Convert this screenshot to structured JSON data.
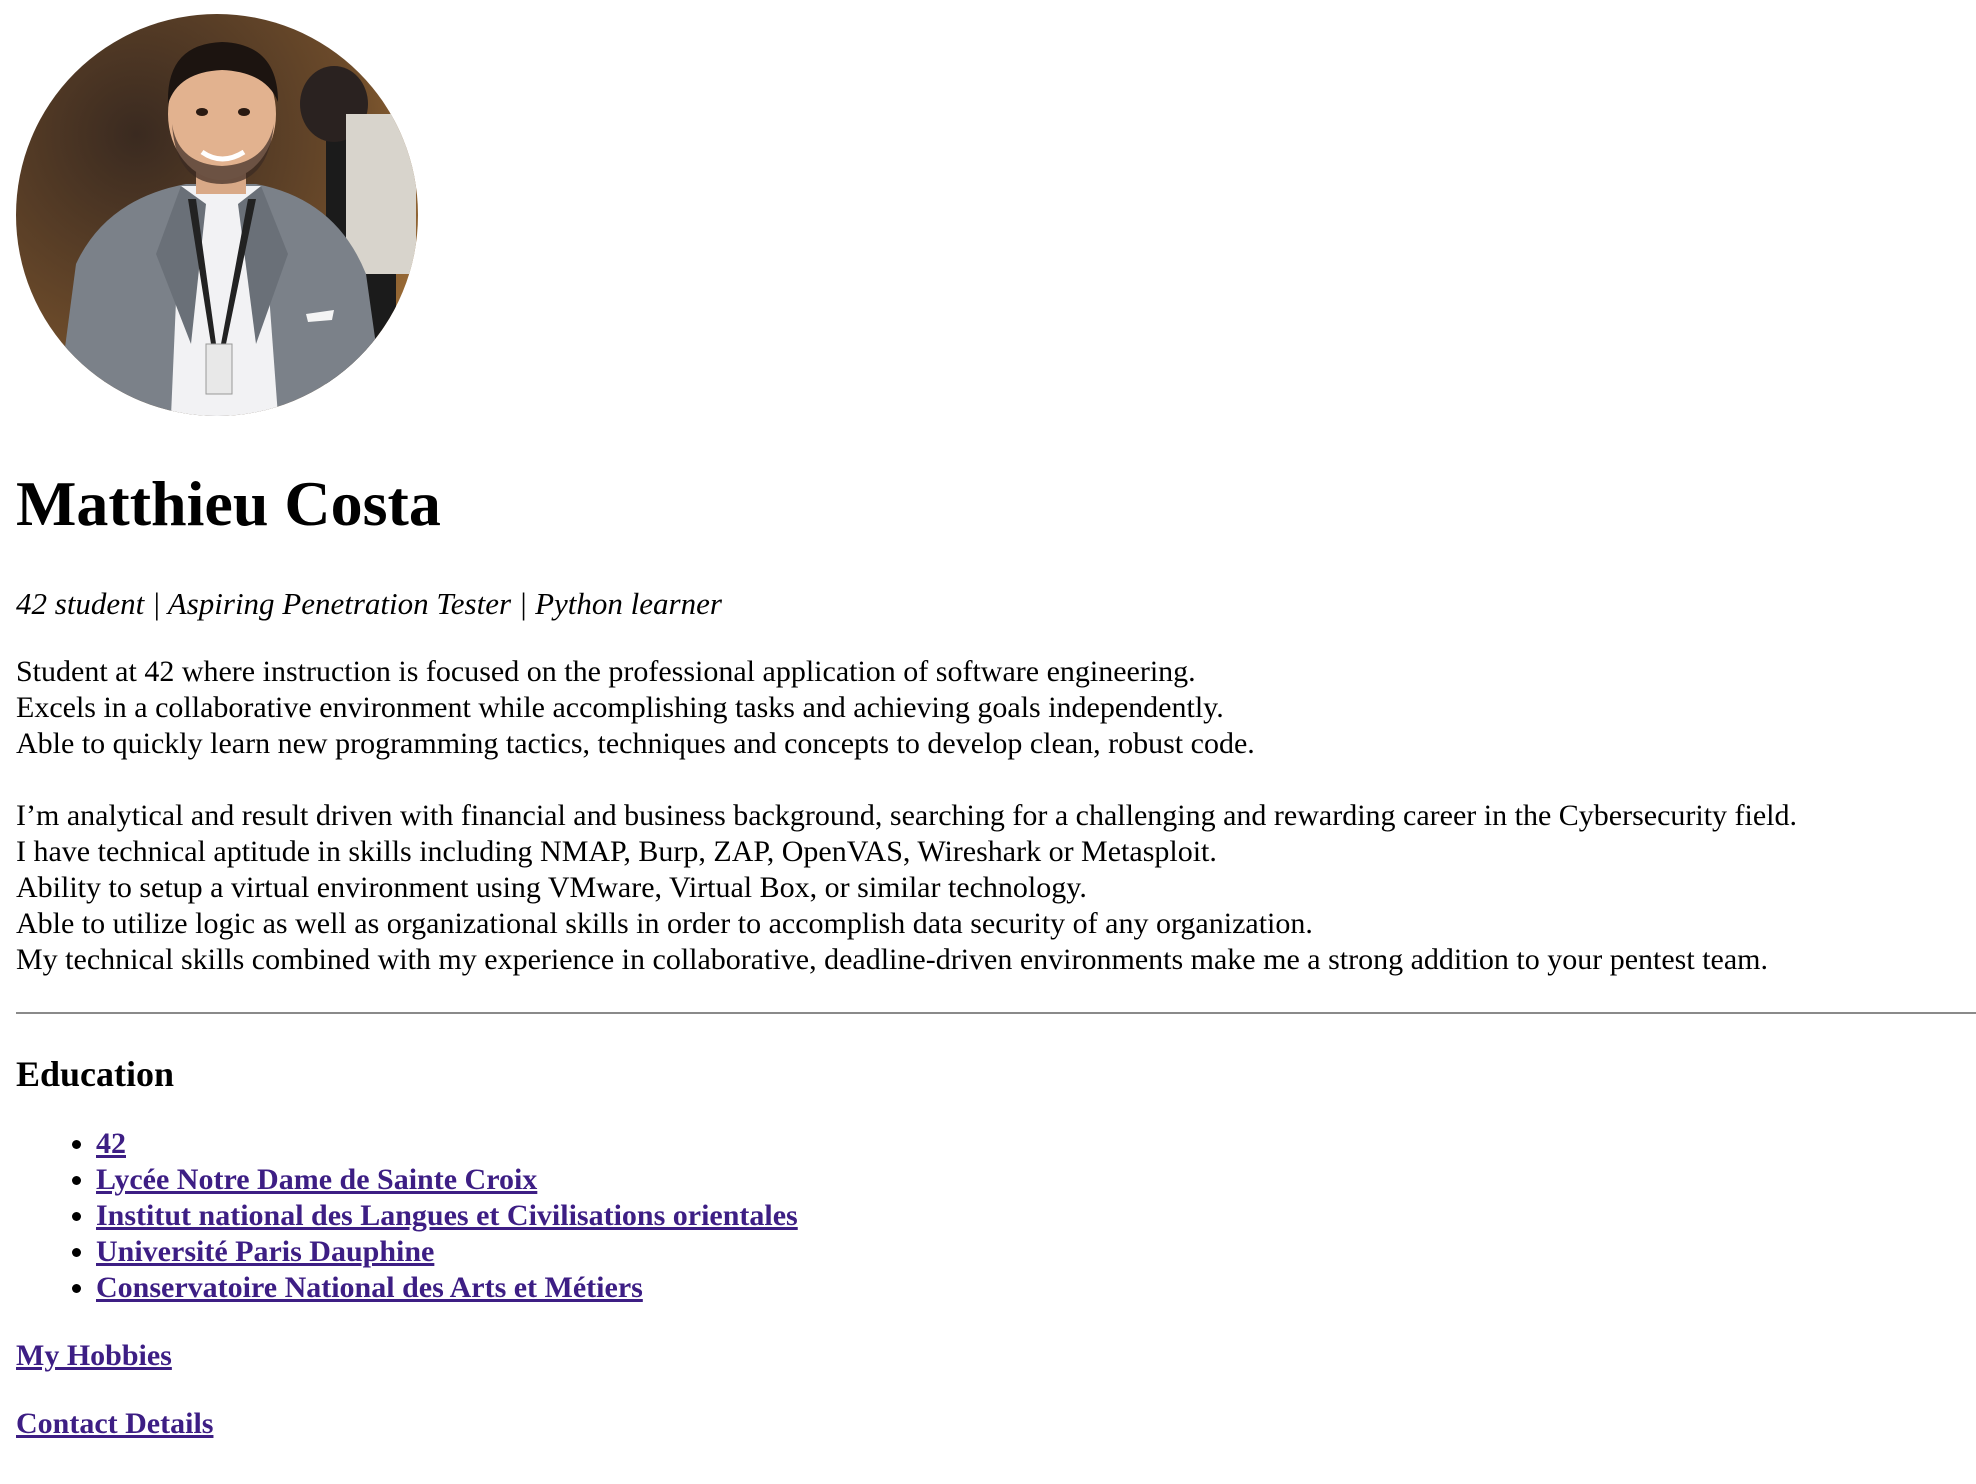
{
  "profile": {
    "photo_icon": "profile-photo",
    "name": "Matthieu Costa",
    "tagline": "42 student | Aspiring Penetration Tester | Python learner"
  },
  "summary": {
    "paragraph1": [
      "Student at 42 where instruction is focused on the professional application of software engineering.",
      "Excels in a collaborative environment while accomplishing tasks and achieving goals independently.",
      "Able to quickly learn new programming tactics, techniques and concepts to develop clean, robust code."
    ],
    "paragraph2": [
      "I’m analytical and result driven with financial and business background, searching for a challenging and rewarding career in the Cybersecurity field.",
      "I have technical aptitude in skills including NMAP, Burp, ZAP, OpenVAS, Wireshark or Metasploit.",
      "Ability to setup a virtual environment using VMware, Virtual Box, or similar technology.",
      "Able to utilize logic as well as organizational skills in order to accomplish data security of any organization.",
      "My technical skills combined with my experience in collaborative, deadline-driven environments make me a strong addition to your pentest team."
    ]
  },
  "education": {
    "title": "Education",
    "items": [
      "42",
      "Lycée Notre Dame de Sainte Croix",
      "Institut national des Langues et Civilisations orientales",
      "Université Paris Dauphine",
      "Conservatoire National des Arts et Métiers"
    ]
  },
  "links": {
    "hobbies": "My Hobbies",
    "contact": "Contact Details"
  },
  "colors": {
    "link": "#3d1e84",
    "rule": "#8a8a8a"
  }
}
